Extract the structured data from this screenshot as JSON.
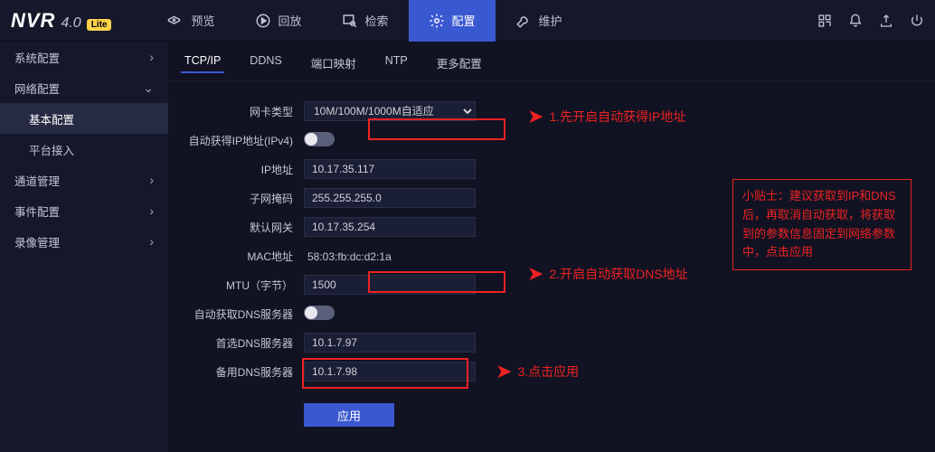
{
  "logo": {
    "main": "NVR",
    "version": "4.0",
    "badge": "Lite"
  },
  "topnav": [
    {
      "icon": "camera",
      "label": "预览"
    },
    {
      "icon": "play",
      "label": "回放"
    },
    {
      "icon": "search",
      "label": "检索"
    },
    {
      "icon": "gear",
      "label": "配置",
      "active": true
    },
    {
      "icon": "wrench",
      "label": "维护"
    }
  ],
  "sidebar": [
    {
      "label": "系统配置",
      "expand": "right"
    },
    {
      "label": "网络配置",
      "expand": "down",
      "children": [
        {
          "label": "基本配置",
          "active": true
        },
        {
          "label": "平台接入"
        }
      ]
    },
    {
      "label": "通道管理",
      "expand": "right"
    },
    {
      "label": "事件配置",
      "expand": "right"
    },
    {
      "label": "录像管理",
      "expand": "right"
    }
  ],
  "subtabs": [
    {
      "label": "TCP/IP",
      "active": true
    },
    {
      "label": "DDNS"
    },
    {
      "label": "端口映射"
    },
    {
      "label": "NTP"
    },
    {
      "label": "更多配置"
    }
  ],
  "form": {
    "nic_type": {
      "label": "网卡类型",
      "value": "10M/100M/1000M自适应"
    },
    "dhcp_ipv4": {
      "label": "自动获得IP地址(IPv4)",
      "on": false
    },
    "ip": {
      "label": "IP地址",
      "value": "10.17.35.117"
    },
    "mask": {
      "label": "子网掩码",
      "value": "255.255.255.0"
    },
    "gateway": {
      "label": "默认网关",
      "value": "10.17.35.254"
    },
    "mac": {
      "label": "MAC地址",
      "value": "58:03:fb:dc:d2:1a"
    },
    "mtu": {
      "label": "MTU（字节）",
      "value": "1500"
    },
    "dhcp_dns": {
      "label": "自动获取DNS服务器",
      "on": false
    },
    "dns1": {
      "label": "首选DNS服务器",
      "value": "10.1.7.97"
    },
    "dns2": {
      "label": "备用DNS服务器",
      "value": "10.1.7.98"
    },
    "apply": "应用"
  },
  "annotations": {
    "step1": "1.先开启自动获得IP地址",
    "step2": "2.开启自动获取DNS地址",
    "step3": "3.点击应用",
    "tip": "小贴士：建议获取到IP和DNS后，再取消自动获取，将获取到的参数信息固定到网络参数中，点击应用"
  }
}
